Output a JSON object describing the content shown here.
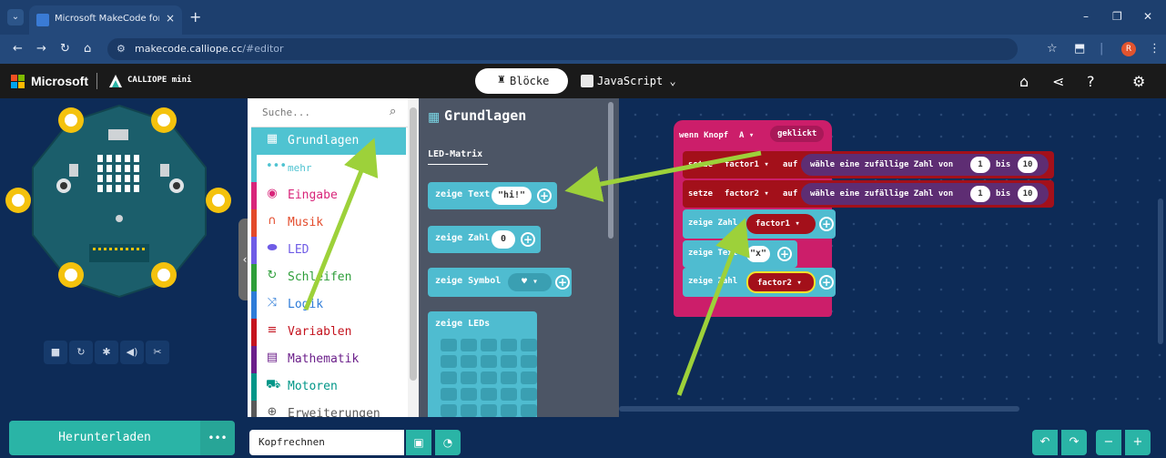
{
  "browser": {
    "tab_title": "Microsoft MakeCode for Calliop",
    "tab_close": "×",
    "new_tab": "+",
    "url_host": "makecode.calliope.cc",
    "url_path": "/#editor",
    "profile_initial": "R",
    "window_min": "–",
    "window_max": "❐",
    "window_close": "✕"
  },
  "header": {
    "brand": "Microsoft",
    "product": "CALLIOPE mini",
    "tab_blocks": "Blöcke",
    "tab_javascript": "JavaScript",
    "tab_javascript_arrow": "⌄"
  },
  "simulator": {
    "tools": [
      "■",
      "↻",
      "✱",
      "◀)",
      "✂"
    ]
  },
  "toolbox": {
    "search_placeholder": "Suche...",
    "categories": [
      {
        "label": "Grundlagen",
        "color": "#4fc3d1",
        "icon": "grid-icon",
        "glyph": "▦"
      },
      {
        "label": "mehr",
        "color": "#4fc3d1",
        "icon": "dots-icon",
        "glyph": "•••"
      },
      {
        "label": "Eingabe",
        "color": "#d8257a",
        "icon": "circle-dot-icon",
        "glyph": "◉"
      },
      {
        "label": "Musik",
        "color": "#e34a2a",
        "icon": "headphones-icon",
        "glyph": "∩"
      },
      {
        "label": "LED",
        "color": "#6f5ce6",
        "icon": "toggle-icon",
        "glyph": "⬬"
      },
      {
        "label": "Schleifen",
        "color": "#2e9e3a",
        "icon": "loop-icon",
        "glyph": "↻"
      },
      {
        "label": "Logik",
        "color": "#2e7cd8",
        "icon": "shuffle-icon",
        "glyph": "⤨"
      },
      {
        "label": "Variablen",
        "color": "#c4131e",
        "icon": "list-icon",
        "glyph": "≡"
      },
      {
        "label": "Mathematik",
        "color": "#6b1f8a",
        "icon": "calculator-icon",
        "glyph": "▤"
      },
      {
        "label": "Motoren",
        "color": "#009688",
        "icon": "car-icon",
        "glyph": "⛟"
      },
      {
        "label": "Erweiterungen",
        "color": "#5a5a5a",
        "icon": "plus-circle-icon",
        "glyph": "⊕"
      }
    ]
  },
  "flyout": {
    "title": "Grundlagen",
    "section": "LED-Matrix",
    "blocks": {
      "show_text_label": "zeige Text",
      "show_text_value": "\"hi!\"",
      "show_number_label": "zeige Zahl",
      "show_number_value": "0",
      "show_icon_label": "zeige Symbol",
      "show_leds_label": "zeige LEDs"
    }
  },
  "workspace": {
    "event_label": "wenn Knopf",
    "event_button": "A ▾",
    "event_action": "geklickt",
    "set1_label": "setze",
    "set1_var": "factor1 ▾",
    "set1_to": "auf",
    "random_label": "wähle eine zufällige Zahl von",
    "random_from": "1",
    "random_to_label": "bis",
    "random_to": "10",
    "set2_label": "setze",
    "set2_var": "factor2 ▾",
    "set2_to": "auf",
    "random2_label": "wähle eine zufällige Zahl von",
    "random2_from": "1",
    "random2_to_label": "bis",
    "random2_to": "10",
    "show_num1_label": "zeige Zahl",
    "show_num1_var": "factor1 ▾",
    "show_text_label": "zeige Text",
    "show_text_value": "\"x\"",
    "show_num2_label": "zeige Zahl",
    "show_num2_var": "factor2 ▾"
  },
  "bottom": {
    "download": "Herunterladen",
    "more": "•••",
    "project_name": "Kopfrechnen"
  },
  "colors": {
    "accent": "#2ab4a6",
    "arrow": "#9dd13a",
    "event": "#cc1e6a",
    "variables": "#a3101a",
    "math": "#5e2d73",
    "basic": "#4fbcd0"
  }
}
